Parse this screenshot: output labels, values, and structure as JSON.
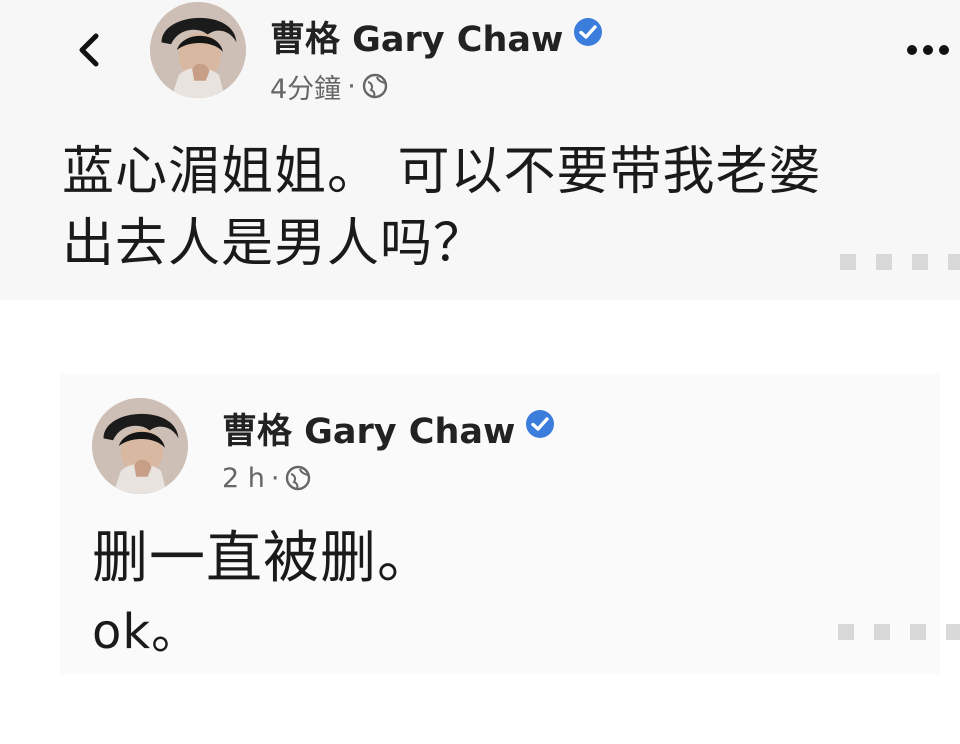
{
  "post1": {
    "author": "曹格 Gary Chaw",
    "time": "4分鐘",
    "separator": "·",
    "lines": [
      "蓝心湄姐姐。 可以不要带我老婆",
      "出去人是男人吗？"
    ]
  },
  "post2": {
    "author": "曹格 Gary Chaw",
    "time": "2 h",
    "separator": "·",
    "lines": [
      "删一直被删。",
      "ok。"
    ]
  },
  "icons": {
    "back": "chevron-left-icon",
    "more": "more-horizontal-icon",
    "verified": "verified-badge-icon",
    "audience": "globe-icon"
  },
  "colors": {
    "verified": "#3b7ddd",
    "text": "#1a1a1a",
    "meta": "#666666"
  }
}
